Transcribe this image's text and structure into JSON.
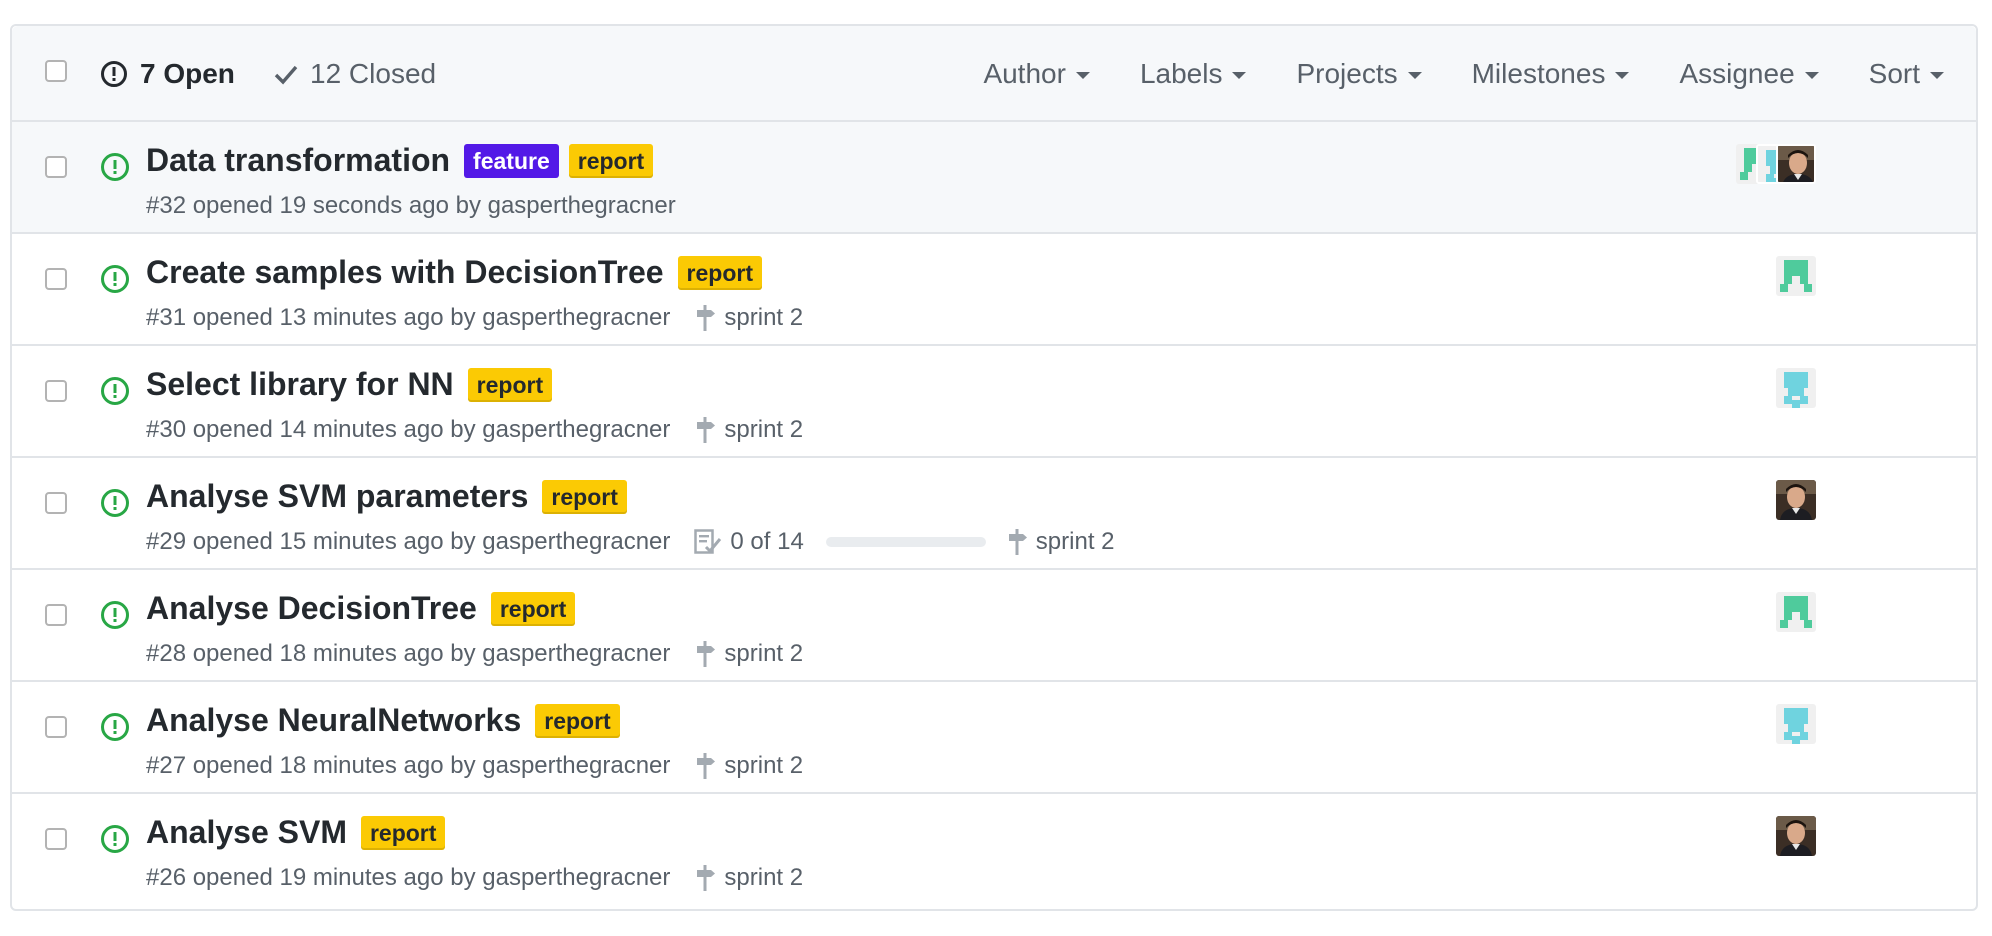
{
  "header": {
    "open_label": "7 Open",
    "closed_label": "12 Closed",
    "filters": [
      "Author",
      "Labels",
      "Projects",
      "Milestones",
      "Assignee",
      "Sort"
    ]
  },
  "colors": {
    "open_green": "#28a745",
    "feature_label": "#5319e7",
    "report_label": "#fbca04"
  },
  "issues": [
    {
      "title": "Data transformation",
      "labels": [
        "feature",
        "report"
      ],
      "meta": "#32 opened 19 seconds ago by gasperthegracner",
      "milestone": "",
      "tasks": "",
      "task_progress": null,
      "assignees": [
        "green-identicon",
        "teal-identicon",
        "photo-avatar"
      ]
    },
    {
      "title": "Create samples with DecisionTree",
      "labels": [
        "report"
      ],
      "meta": "#31 opened 13 minutes ago by gasperthegracner",
      "milestone": "sprint 2",
      "tasks": "",
      "task_progress": null,
      "assignees": [
        "green-identicon"
      ]
    },
    {
      "title": "Select library for NN",
      "labels": [
        "report"
      ],
      "meta": "#30 opened 14 minutes ago by gasperthegracner",
      "milestone": "sprint 2",
      "tasks": "",
      "task_progress": null,
      "assignees": [
        "teal-identicon"
      ]
    },
    {
      "title": "Analyse SVM parameters",
      "labels": [
        "report"
      ],
      "meta": "#29 opened 15 minutes ago by gasperthegracner",
      "milestone": "sprint 2",
      "tasks": "0 of 14",
      "task_progress": 0,
      "assignees": [
        "photo-avatar"
      ]
    },
    {
      "title": "Analyse DecisionTree",
      "labels": [
        "report"
      ],
      "meta": "#28 opened 18 minutes ago by gasperthegracner",
      "milestone": "sprint 2",
      "tasks": "",
      "task_progress": null,
      "assignees": [
        "green-identicon"
      ]
    },
    {
      "title": "Analyse NeuralNetworks",
      "labels": [
        "report"
      ],
      "meta": "#27 opened 18 minutes ago by gasperthegracner",
      "milestone": "sprint 2",
      "tasks": "",
      "task_progress": null,
      "assignees": [
        "teal-identicon"
      ]
    },
    {
      "title": "Analyse SVM",
      "labels": [
        "report"
      ],
      "meta": "#26 opened 19 minutes ago by gasperthegracner",
      "milestone": "sprint 2",
      "tasks": "",
      "task_progress": null,
      "assignees": [
        "photo-avatar"
      ]
    }
  ]
}
